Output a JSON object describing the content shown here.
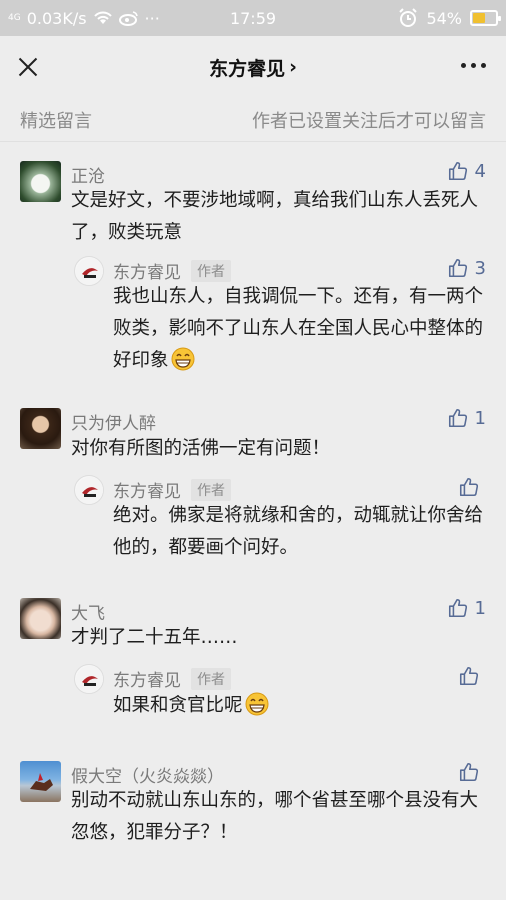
{
  "status_bar": {
    "signal": "4G",
    "speed": "0.03K/s",
    "time": "17:59",
    "battery": "54%",
    "battery_level": 0.54,
    "icons": [
      "signal-icon",
      "wifi-icon",
      "weibo-icon",
      "more-dots-icon",
      "alarm-icon",
      "battery-icon"
    ]
  },
  "nav": {
    "title": "东方睿见",
    "title_chevron": "›"
  },
  "section": {
    "left": "精选留言",
    "right": "作者已设置关注后才可以留言"
  },
  "comments": [
    {
      "name": "正沧",
      "text": "文是好文，不要涉地域啊，真给我们山东人丢死人了，败类玩意",
      "likes": "4",
      "reply": {
        "name": "东方睿见",
        "tag": "作者",
        "text": "我也山东人，自我调侃一下。还有，有一两个败类，影响不了山东人在全国人民心中整体的好印象",
        "likes": "3",
        "emoji": "grin-emoji"
      }
    },
    {
      "name": "只为伊人醉",
      "text": "对你有所图的活佛一定有问题！",
      "likes": "1",
      "reply": {
        "name": "东方睿见",
        "tag": "作者",
        "text": "绝对。佛家是将就缘和舍的，动辄就让你舍给他的，都要画个问好。",
        "likes": ""
      }
    },
    {
      "name": "大飞",
      "text": "才判了二十五年……",
      "likes": "1",
      "reply": {
        "name": "东方睿见",
        "tag": "作者",
        "text": "如果和贪官比呢",
        "likes": "",
        "emoji": "grin-emoji"
      }
    },
    {
      "name": "假大空（火炎焱燚）",
      "text": "别动不动就山东山东的，哪个省甚至哪个县没有大忽悠，犯罪分子？！",
      "likes": ""
    }
  ],
  "colors": {
    "like": "#576b95",
    "background": "#ededed",
    "statusbar": "#cfcfcf",
    "name": "#7a7a7a"
  }
}
